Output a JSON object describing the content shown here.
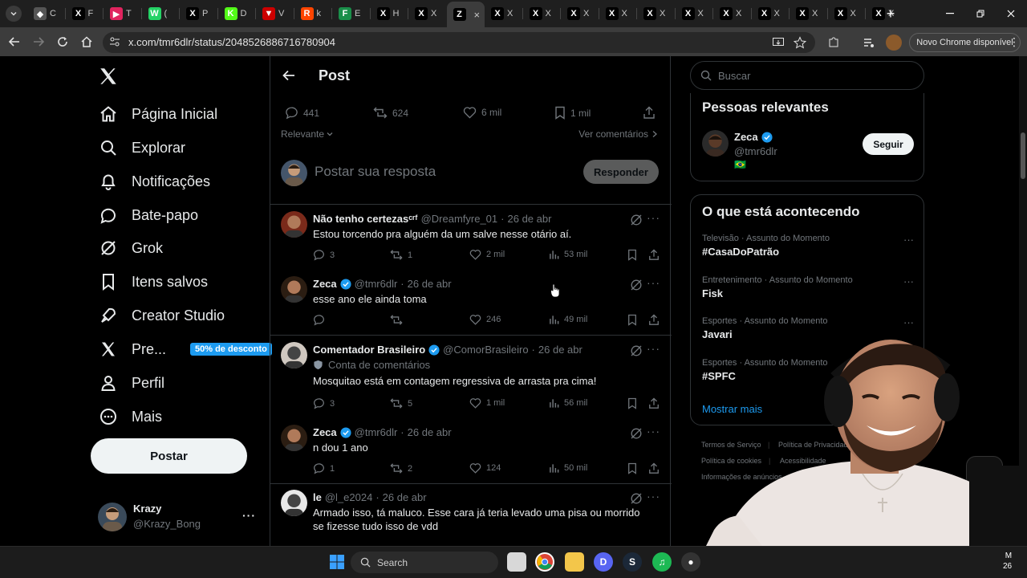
{
  "browser": {
    "tabs": [
      {
        "fav": "◆",
        "color": "#555",
        "title": "C"
      },
      {
        "fav": "X",
        "color": "#000",
        "title": "F"
      },
      {
        "fav": "▶",
        "color": "#e0245e",
        "title": "T"
      },
      {
        "fav": "W",
        "color": "#25d366",
        "title": "("
      },
      {
        "fav": "X",
        "color": "#000",
        "title": "P"
      },
      {
        "fav": "K",
        "color": "#53fc18",
        "title": "D"
      },
      {
        "fav": "▼",
        "color": "#c00",
        "title": "V"
      },
      {
        "fav": "R",
        "color": "#ff4500",
        "title": "k"
      },
      {
        "fav": "F",
        "color": "#1a8f4a",
        "title": "E"
      },
      {
        "fav": "X",
        "color": "#000",
        "title": "H"
      },
      {
        "fav": "X",
        "color": "#000",
        "title": "X"
      },
      {
        "fav": "Z",
        "color": "#000",
        "title": ""
      },
      {
        "fav": "X",
        "color": "#000",
        "title": "X"
      },
      {
        "fav": "X",
        "color": "#000",
        "title": "X"
      },
      {
        "fav": "X",
        "color": "#000",
        "title": "X"
      },
      {
        "fav": "X",
        "color": "#000",
        "title": "X"
      },
      {
        "fav": "X",
        "color": "#000",
        "title": "X"
      },
      {
        "fav": "X",
        "color": "#000",
        "title": "X"
      },
      {
        "fav": "X",
        "color": "#000",
        "title": "X"
      },
      {
        "fav": "X",
        "color": "#000",
        "title": "X"
      },
      {
        "fav": "X",
        "color": "#000",
        "title": "X"
      },
      {
        "fav": "X",
        "color": "#000",
        "title": "X"
      },
      {
        "fav": "X",
        "color": "#000",
        "title": "X"
      }
    ],
    "active_tab_index": 11,
    "url": "x.com/tmr6dlr/status/2048526886716780904",
    "chrome_update_label": "Novo Chrome disponível"
  },
  "sidebar": {
    "items": [
      {
        "label": "Página Inicial",
        "icon": "home-icon"
      },
      {
        "label": "Explorar",
        "icon": "search-icon"
      },
      {
        "label": "Notificações",
        "icon": "bell-icon"
      },
      {
        "label": "Bate-papo",
        "icon": "chat-icon"
      },
      {
        "label": "Grok",
        "icon": "grok-icon"
      },
      {
        "label": "Itens salvos",
        "icon": "bookmark-icon"
      },
      {
        "label": "Creator Studio",
        "icon": "rocket-icon"
      },
      {
        "label": "Pre...",
        "icon": "x-logo-icon"
      },
      {
        "label": "Perfil",
        "icon": "user-icon"
      },
      {
        "label": "Mais",
        "icon": "more-circle-icon"
      }
    ],
    "promo_badge": "50% de desconto",
    "post_button": "Postar",
    "account": {
      "name": "Krazy",
      "handle": "@Krazy_Bong"
    }
  },
  "main": {
    "title": "Post",
    "metrics": {
      "replies": "441",
      "reposts": "624",
      "likes": "6 mil",
      "bookmarks": "1 mil"
    },
    "sort_label": "Relevante",
    "view_comments": "Ver comentários",
    "reply_placeholder": "Postar sua resposta",
    "reply_button": "Responder",
    "replies": [
      {
        "name": "Não tenho certezasᶜʳᶠ",
        "verified": false,
        "handle": "@Dreamfyre_01",
        "date": "26 de abr",
        "text": "Estou torcendo pra alguém da um salve nesse otário aí.",
        "replies": "3",
        "reposts": "1",
        "likes": "2 mil",
        "views": "53 mil"
      },
      {
        "name": "Zeca",
        "verified": true,
        "handle": "@tmr6dlr",
        "date": "26 de abr",
        "text": "esse ano ele ainda toma",
        "replies": "",
        "reposts": "",
        "likes": "246",
        "views": "49 mil"
      },
      {
        "name": "Comentador Brasileiro",
        "verified": true,
        "handle": "@ComorBrasileiro",
        "date": "26 de abr",
        "label": "Conta de comentários",
        "text": "Mosquitao está em contagem regressiva de arrasta pra cima!",
        "replies": "3",
        "reposts": "5",
        "likes": "1 mil",
        "views": "56 mil"
      },
      {
        "name": "Zeca",
        "verified": true,
        "handle": "@tmr6dlr",
        "date": "26 de abr",
        "text": "n dou 1 ano",
        "replies": "1",
        "reposts": "2",
        "likes": "124",
        "views": "50 mil"
      },
      {
        "name": "le",
        "verified": false,
        "handle": "@l_e2024",
        "date": "26 de abr",
        "text": "Armado isso, tá maluco. Esse cara já teria levado uma pisa ou morrido se fizesse tudo isso de vdd"
      }
    ]
  },
  "right": {
    "search_placeholder": "Buscar",
    "relevant_title": "Pessoas relevantes",
    "person": {
      "name": "Zeca",
      "handle": "@tmr6dlr",
      "flag": "🇧🇷",
      "follow": "Seguir"
    },
    "trends_title": "O que está acontecendo",
    "trends": [
      {
        "cat": "Televisão · Assunto do Momento",
        "name": "#CasaDoPatrão"
      },
      {
        "cat": "Entretenimento · Assunto do Momento",
        "name": "Fisk"
      },
      {
        "cat": "Esportes · Assunto do Momento",
        "name": "Javari"
      },
      {
        "cat": "Esportes · Assunto do Momento",
        "name": "#SPFC"
      }
    ],
    "show_more": "Mostrar mais",
    "footer": [
      "Termos de Serviço",
      "Política de Privacidade",
      "Política de cookies",
      "Acessibilidade",
      "Informações de anúncios"
    ]
  },
  "taskbar": {
    "search_label": "Search",
    "clock_line1": "M",
    "clock_line2": "26"
  },
  "colors": {
    "accent": "#1d9bf0",
    "bg": "#000000",
    "border": "#2f3336",
    "muted": "#71767b"
  }
}
